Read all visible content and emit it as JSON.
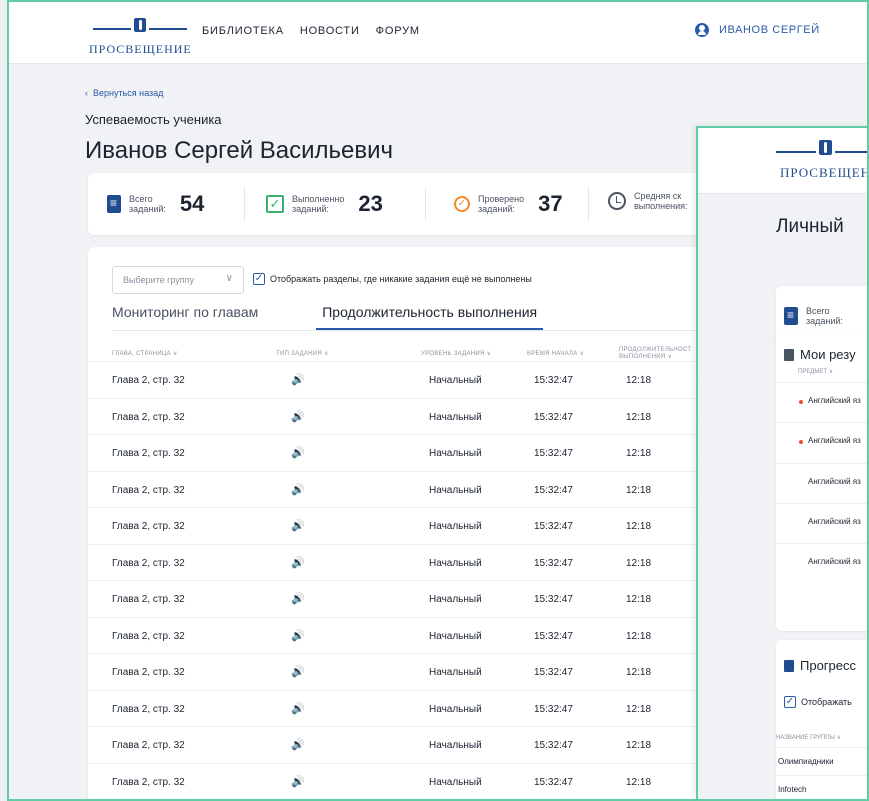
{
  "brand": {
    "name": "ПРОСВЕЩЕНИЕ"
  },
  "nav": {
    "items": [
      "БИБЛИОТЕКА",
      "НОВОСТИ",
      "ФОРУМ"
    ]
  },
  "user": {
    "name": "ИВАНОВ СЕРГЕЙ"
  },
  "back_link": "Вернуться назад",
  "page_subtitle": "Успеваемость ученика",
  "page_title": "Иванов Сергей Васильевич",
  "stats": [
    {
      "label_1": "Всего",
      "label_2": "заданий:",
      "value": "54",
      "icon": "clipboard-icon"
    },
    {
      "label_1": "Выполненно",
      "label_2": "заданий:",
      "value": "23",
      "icon": "check-icon"
    },
    {
      "label_1": "Проверено",
      "label_2": "заданий:",
      "value": "37",
      "icon": "check-search-icon"
    },
    {
      "label_1": "Средняя ск",
      "label_2": "выполнения:",
      "value": "",
      "icon": "clock-icon"
    }
  ],
  "filters": {
    "group_placeholder": "Выберите группу",
    "checkbox_label": "Отображать разделы, где никакие задания ещё не выполнены",
    "checkbox_checked": true
  },
  "tabs": [
    {
      "label": "Мониторинг по главам",
      "active": false
    },
    {
      "label": "Продолжительность выполнения",
      "active": true
    }
  ],
  "table": {
    "columns": [
      "ГЛАВА, СТРАНИЦА ∨",
      "ТИП ЗАДАНИЯ ∨",
      "УРОВЕНЬ ЗАДАНИЯ ∨",
      "ВРЕМЯ НАЧАЛА ∨",
      "ПРОДОЛЖИТЕЛЬНОСТ",
      "ВЫПОЛНЕНИЯ ∨"
    ],
    "rows": [
      {
        "chapter": "Глава 2, стр. 32",
        "type_icon": "speaker-icon",
        "level": "Начальный",
        "start": "15:32:47",
        "duration": "12:18"
      },
      {
        "chapter": "Глава 2, стр. 32",
        "type_icon": "speaker-icon",
        "level": "Начальный",
        "start": "15:32:47",
        "duration": "12:18"
      },
      {
        "chapter": "Глава 2, стр. 32",
        "type_icon": "speaker-icon",
        "level": "Начальный",
        "start": "15:32:47",
        "duration": "12:18"
      },
      {
        "chapter": "Глава 2, стр. 32",
        "type_icon": "speaker-icon",
        "level": "Начальный",
        "start": "15:32:47",
        "duration": "12:18"
      },
      {
        "chapter": "Глава 2, стр. 32",
        "type_icon": "speaker-icon",
        "level": "Начальный",
        "start": "15:32:47",
        "duration": "12:18"
      },
      {
        "chapter": "Глава 2, стр. 32",
        "type_icon": "speaker-icon",
        "level": "Начальный",
        "start": "15:32:47",
        "duration": "12:18"
      },
      {
        "chapter": "Глава 2, стр. 32",
        "type_icon": "speaker-icon",
        "level": "Начальный",
        "start": "15:32:47",
        "duration": "12:18"
      },
      {
        "chapter": "Глава 2, стр. 32",
        "type_icon": "speaker-icon",
        "level": "Начальный",
        "start": "15:32:47",
        "duration": "12:18"
      },
      {
        "chapter": "Глава 2, стр. 32",
        "type_icon": "speaker-icon",
        "level": "Начальный",
        "start": "15:32:47",
        "duration": "12:18"
      },
      {
        "chapter": "Глава 2, стр. 32",
        "type_icon": "speaker-icon",
        "level": "Начальный",
        "start": "15:32:47",
        "duration": "12:18"
      },
      {
        "chapter": "Глава 2, стр. 32",
        "type_icon": "speaker-icon",
        "level": "Начальный",
        "start": "15:32:47",
        "duration": "12:18"
      },
      {
        "chapter": "Глава 2, стр. 32",
        "type_icon": "speaker-icon",
        "level": "Начальный",
        "start": "15:32:47",
        "duration": "12:18"
      }
    ]
  },
  "front": {
    "brand": "ПРОСВЕЩЕН",
    "title": "Личный",
    "stat_label_1": "Всего",
    "stat_label_2": "заданий:",
    "results_title": "Мои резу",
    "results_col": "ПРЕДМЕТ ∨",
    "results_rows": [
      "Английский яз",
      "Английский яз",
      "Английский яз",
      "Английский яз",
      "Английский яз"
    ],
    "progress_title": "Прогресс",
    "progress_checkbox": "Отображать",
    "groups_col": "НАЗВАНИЕ ГРУППЫ ∨",
    "groups": [
      "Олимпиадники",
      "Infotech"
    ]
  },
  "colors": {
    "accent": "#2a5aa8",
    "brand": "#1f4d8f",
    "frame": "#5ecfa5",
    "done": "#39b36b",
    "checked": "#f08a2c",
    "alert_dot": "#e0552f"
  }
}
